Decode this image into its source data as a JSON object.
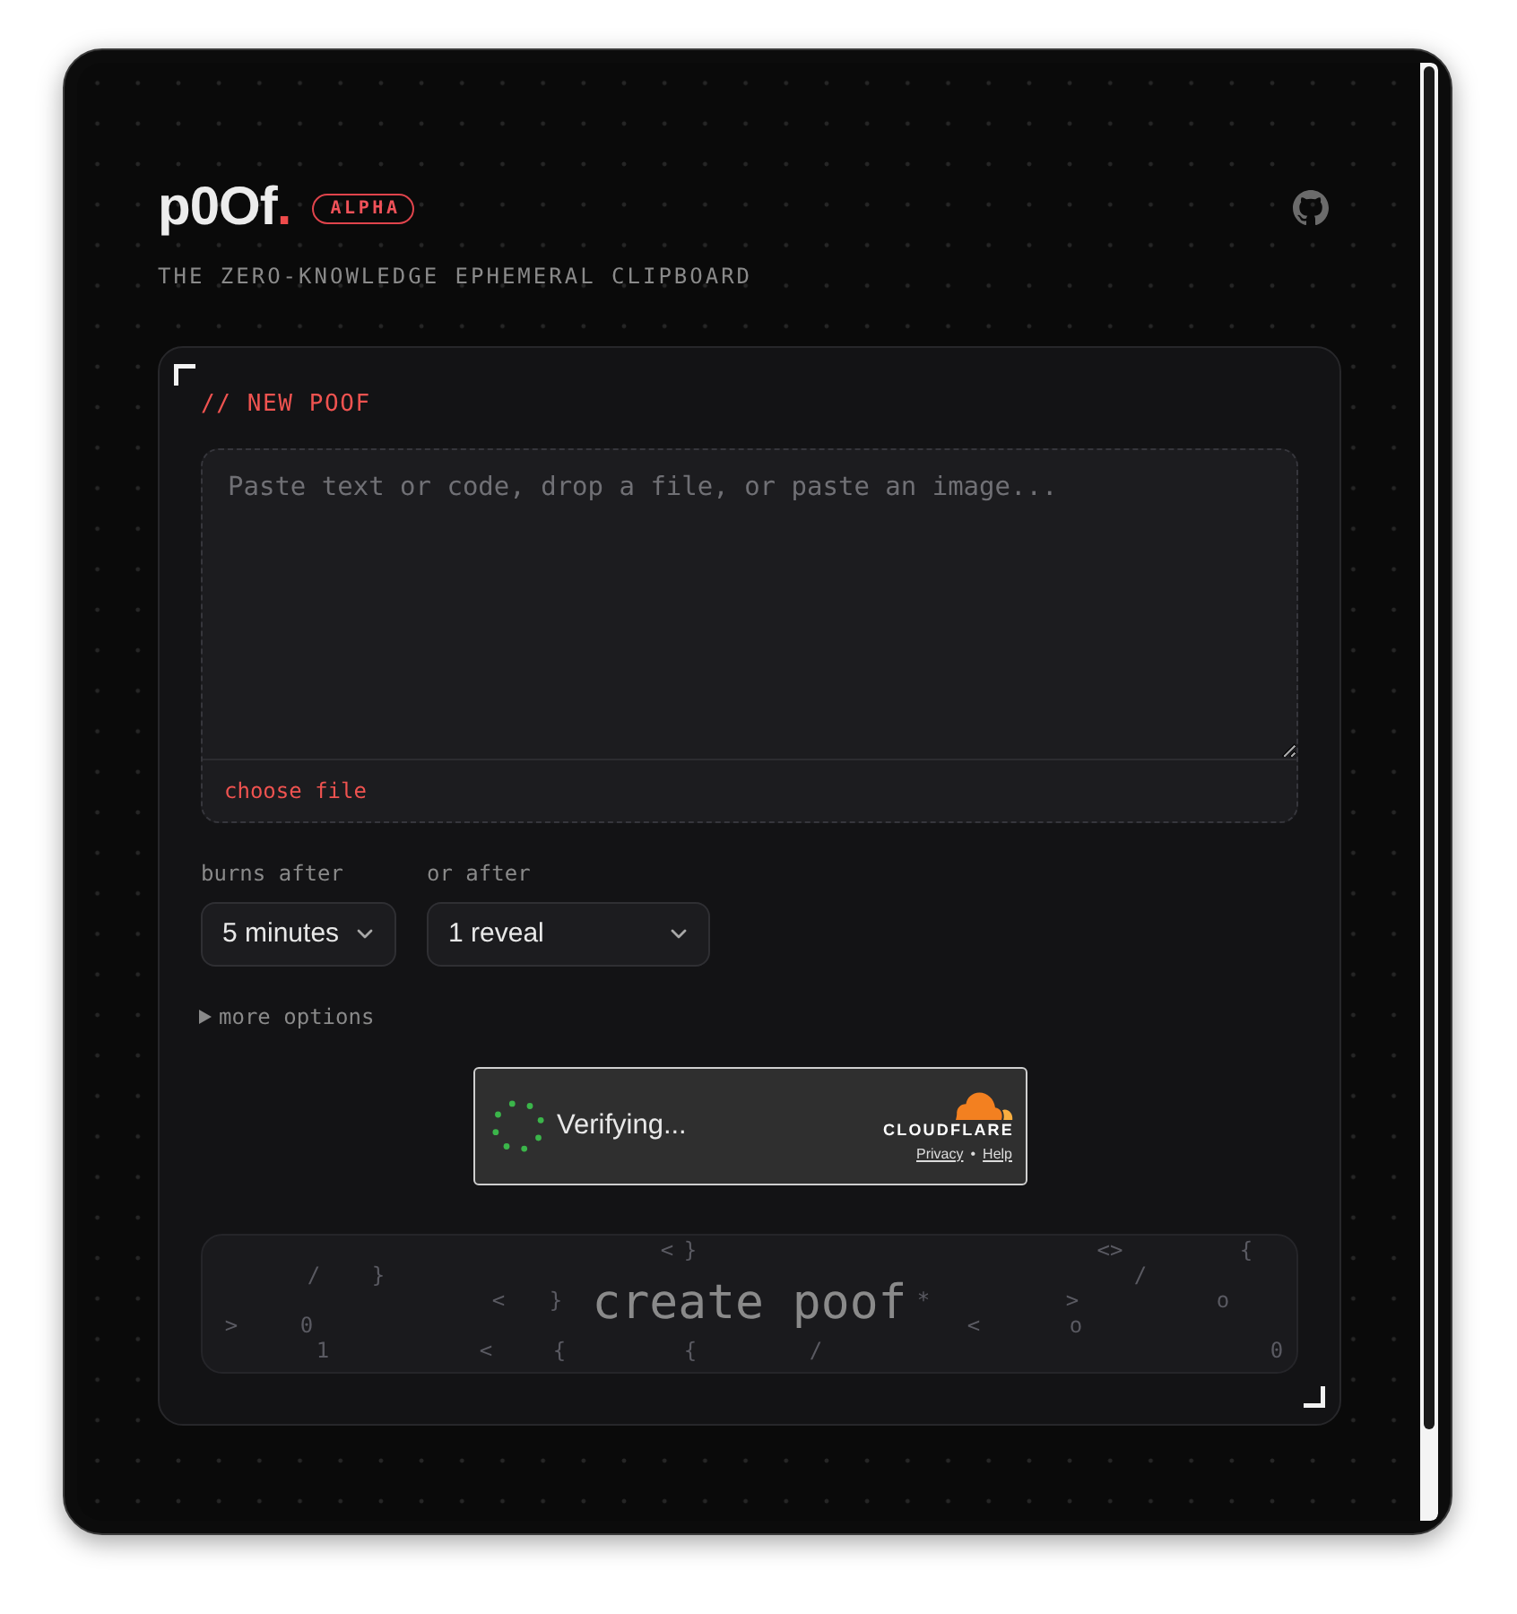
{
  "header": {
    "logo": {
      "text": "p0Of",
      "accent": "."
    },
    "badge": "ALPHA",
    "tagline": "THE ZERO-KNOWLEDGE EPHEMERAL CLIPBOARD"
  },
  "form": {
    "heading": "// NEW POOF",
    "content_field": {
      "placeholder": "Paste text or code, drop a file, or paste an image..."
    },
    "file_button": "choose file",
    "dropdowns": [
      {
        "label": "burns after",
        "value": "5 minutes"
      },
      {
        "label": "or after",
        "value": "1 reveal"
      }
    ],
    "more_options": {
      "label": "more options",
      "expanded": false
    },
    "verification": {
      "status": "Verifying...",
      "provider": "CLOUDFLARE",
      "links": [
        "Privacy",
        "Help"
      ],
      "separator": "•"
    },
    "submit": {
      "label": "create poof",
      "disabled": true,
      "glyphs": [
        "<",
        "}",
        "<>",
        "{",
        "/",
        "}",
        "/",
        "<",
        "}",
        "*",
        ">",
        "o",
        ">",
        "0",
        "<",
        "o",
        "1",
        "<",
        "{",
        "{",
        "/",
        "0"
      ]
    }
  }
}
